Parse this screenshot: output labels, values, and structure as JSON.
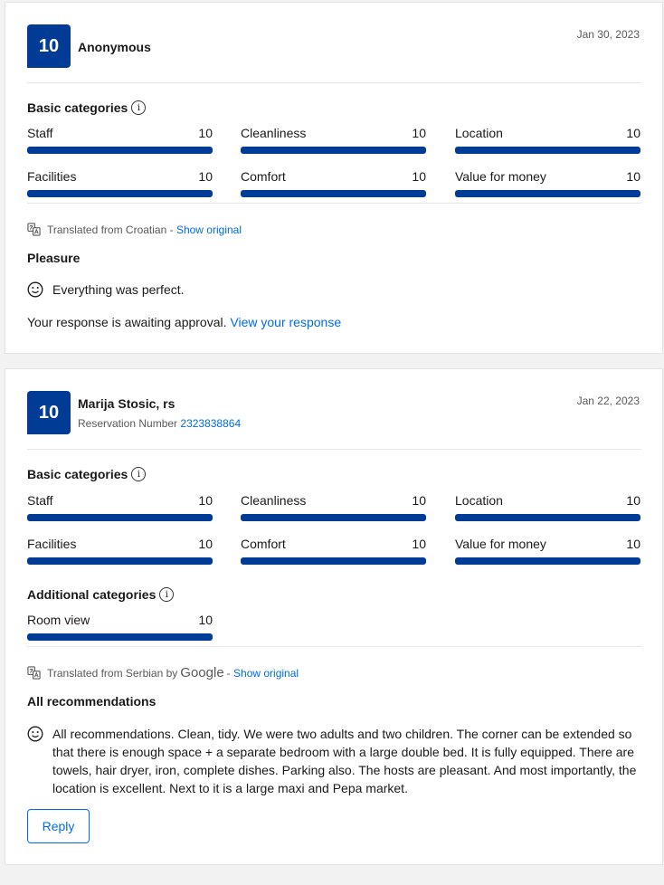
{
  "reviews": [
    {
      "score": "10",
      "name": "Anonymous",
      "date": "Jan 30, 2023",
      "basic_heading": "Basic categories",
      "basic": [
        {
          "label": "Staff",
          "value": "10",
          "fill": 1.0
        },
        {
          "label": "Cleanliness",
          "value": "10",
          "fill": 1.0
        },
        {
          "label": "Location",
          "value": "10",
          "fill": 1.0
        },
        {
          "label": "Facilities",
          "value": "10",
          "fill": 1.0
        },
        {
          "label": "Comfort",
          "value": "10",
          "fill": 1.0
        },
        {
          "label": "Value for money",
          "value": "10",
          "fill": 1.0
        }
      ],
      "translated": "Translated from Croatian -",
      "show_original": "Show original",
      "title": "Pleasure",
      "text": "Everything was perfect.",
      "await_text": "Your response is awaiting approval.",
      "view_response": "View your response"
    },
    {
      "score": "10",
      "name": "Marija Stosic, rs",
      "reservation_label": "Reservation Number",
      "reservation_number": "2323838864",
      "date": "Jan 22, 2023",
      "basic_heading": "Basic categories",
      "basic": [
        {
          "label": "Staff",
          "value": "10",
          "fill": 1.0
        },
        {
          "label": "Cleanliness",
          "value": "10",
          "fill": 1.0
        },
        {
          "label": "Location",
          "value": "10",
          "fill": 1.0
        },
        {
          "label": "Facilities",
          "value": "10",
          "fill": 1.0
        },
        {
          "label": "Comfort",
          "value": "10",
          "fill": 1.0
        },
        {
          "label": "Value for money",
          "value": "10",
          "fill": 1.0
        }
      ],
      "additional_heading": "Additional categories",
      "additional": [
        {
          "label": "Room view",
          "value": "10",
          "fill": 1.0
        }
      ],
      "translated": "Translated from Serbian by",
      "google": "Google",
      "translated_sep": "-",
      "show_original": "Show original",
      "title": "All recommendations",
      "text": "All recommendations. Clean, tidy. We were two adults and two children. The corner can be extended so that there is enough space + a separate bedroom with a large double bed. It is fully equipped. There are towels, hair dryer, iron, complete dishes. Parking also. The hosts are pleasant. And most importantly, the location is excellent. Next to it is a large maxi and Pepa market.",
      "reply_label": "Reply"
    }
  ],
  "icons": {
    "info": "info-icon",
    "translate": "translate-icon",
    "smile": "smiley-icon"
  },
  "colors": {
    "score_bg": "#003b95",
    "bar": "#003b95",
    "link": "#006ce4"
  }
}
